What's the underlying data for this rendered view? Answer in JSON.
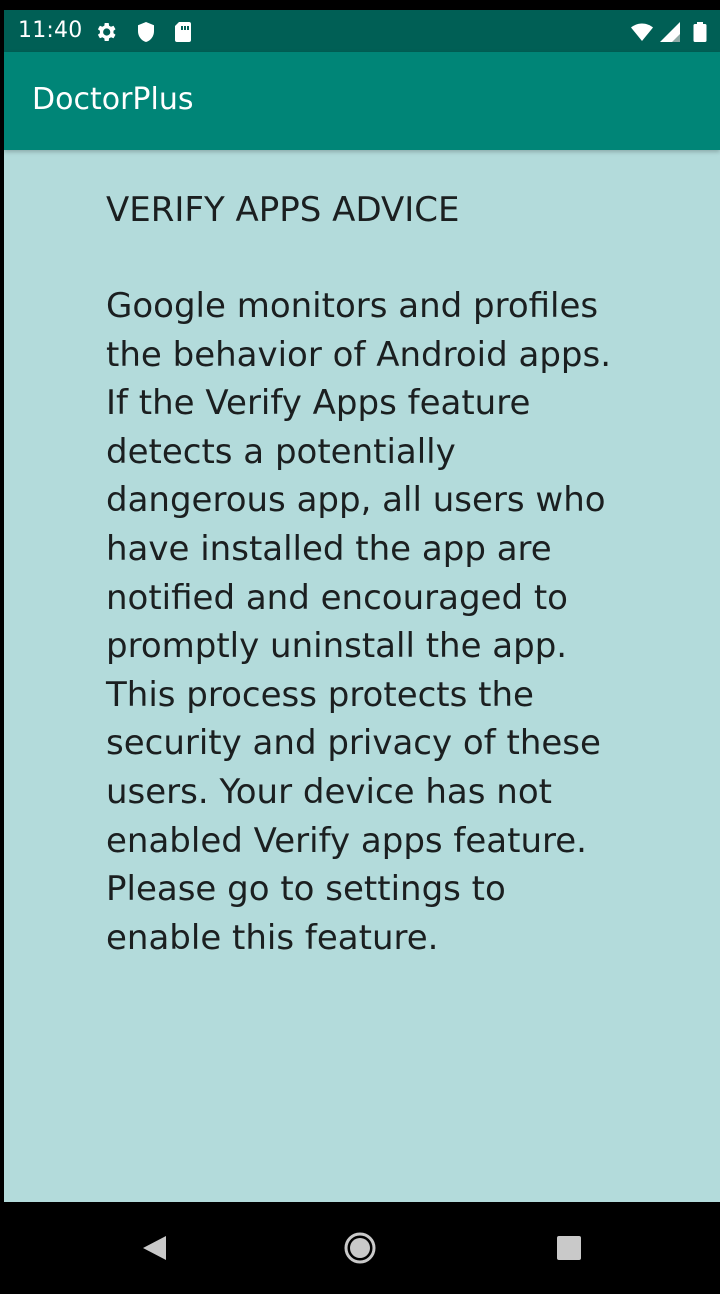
{
  "status_bar": {
    "time": "11:40",
    "icons_left": [
      "settings-gear-icon",
      "shield-icon",
      "sd-card-icon"
    ],
    "icons_right": [
      "wifi-icon",
      "cellular-signal-icon",
      "battery-icon"
    ]
  },
  "app_bar": {
    "title": "DoctorPlus"
  },
  "content": {
    "heading": "VERIFY APPS ADVICE",
    "body": "Google monitors and profiles the behavior of Android apps. If the Verify Apps feature detects a potentially dangerous app, all users who have installed the app are notified and encouraged to promptly uninstall the app. This process protects the security and privacy of these users. Your device has not enabled Verify apps feature. Please go to settings to enable this feature."
  },
  "navigation": {
    "buttons": [
      "back-icon",
      "home-icon",
      "recents-icon"
    ]
  },
  "colors": {
    "status_bar": "#005f55",
    "app_bar": "#008577",
    "screen_background": "#b3dbdb",
    "text": "#1b1f20",
    "navigation_bar": "#000000"
  }
}
